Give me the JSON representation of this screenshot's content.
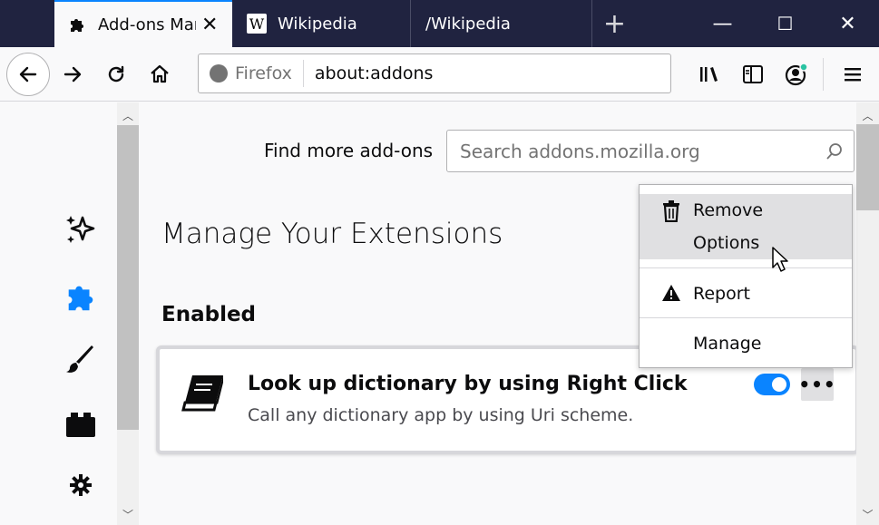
{
  "tabs": [
    {
      "label": "Add-ons Manager",
      "active": true,
      "icon": "puzzle-icon"
    },
    {
      "label": "Wikipedia",
      "active": false,
      "icon": "wikipedia-icon"
    },
    {
      "label": "/Wikipedia",
      "active": false
    }
  ],
  "window_controls": {
    "minimize": "—",
    "maximize": "☐",
    "close": "✕"
  },
  "newtab_glyph": "+",
  "urlbar": {
    "identity_label": "Firefox",
    "url": "about:addons"
  },
  "find_more": {
    "label": "Find more add-ons",
    "placeholder": "Search addons.mozilla.org"
  },
  "page": {
    "heading": "Manage Your Extensions",
    "section_label": "Enabled"
  },
  "extension": {
    "name": "Look up dictionary by using Right Click",
    "description": "Call any dictionary app by using Uri scheme.",
    "enabled": true,
    "more_label": "•••"
  },
  "menu": {
    "items": [
      {
        "label": "Remove",
        "icon": "trash-icon"
      },
      {
        "label": "Options"
      },
      {
        "label": "Report",
        "icon": "warning-icon"
      },
      {
        "label": "Manage"
      }
    ]
  },
  "colors": {
    "accent": "#0a84ff",
    "tabstrip": "#202340"
  }
}
